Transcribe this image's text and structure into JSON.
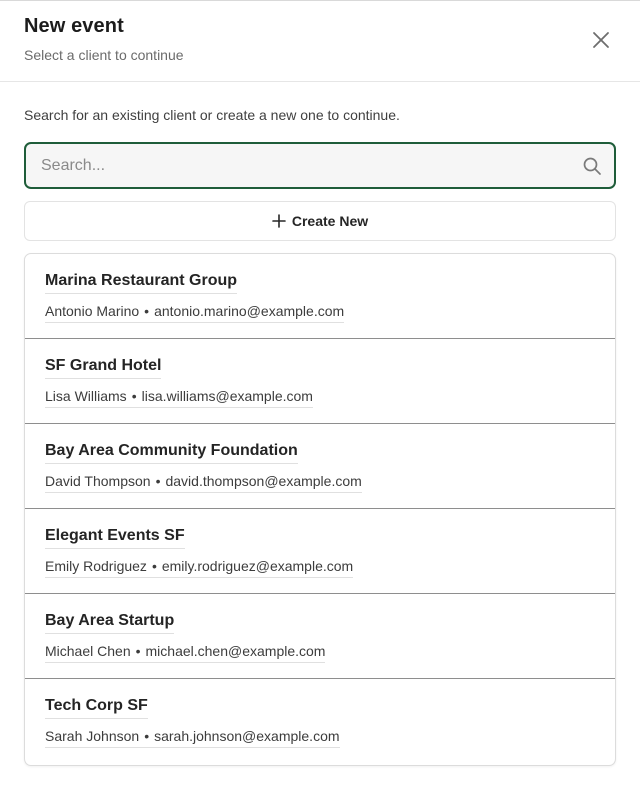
{
  "header": {
    "title": "New event",
    "subtitle": "Select a client to continue",
    "close_icon": "close-icon"
  },
  "intro_text": "Search for an existing client or create a new one to continue.",
  "search": {
    "value": "",
    "placeholder": "Search...",
    "icon": "search-icon",
    "focus_color": "#1f5d3a"
  },
  "create_button": {
    "label": "Create New",
    "icon": "plus-icon"
  },
  "clients": [
    {
      "name": "Marina Restaurant Group",
      "contact": "Antonio Marino",
      "email": "antonio.marino@example.com"
    },
    {
      "name": "SF Grand Hotel",
      "contact": "Lisa Williams",
      "email": "lisa.williams@example.com"
    },
    {
      "name": "Bay Area Community Foundation",
      "contact": "David Thompson",
      "email": "david.thompson@example.com"
    },
    {
      "name": "Elegant Events SF",
      "contact": "Emily Rodriguez",
      "email": "emily.rodriguez@example.com"
    },
    {
      "name": "Bay Area Startup",
      "contact": "Michael Chen",
      "email": "michael.chen@example.com"
    },
    {
      "name": "Tech Corp SF",
      "contact": "Sarah Johnson",
      "email": "sarah.johnson@example.com"
    }
  ],
  "separator": "•"
}
